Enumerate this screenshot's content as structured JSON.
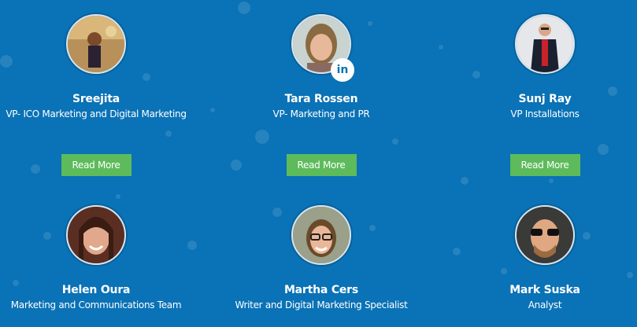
{
  "colors": {
    "background": "#0a72b6",
    "button": "#5dbb5b",
    "linkedin": "#0a72b6"
  },
  "team": [
    {
      "name": "Sreejita",
      "role": "VP- ICO Marketing and Digital Marketing",
      "button": "Read More",
      "avatar_icon": "person-photo"
    },
    {
      "name": "Tara Rossen",
      "role": "VP- Marketing and PR",
      "button": "Read More",
      "avatar_icon": "person-photo",
      "social_icon": "linkedin-icon",
      "social_label": "in"
    },
    {
      "name": "Sunj Ray",
      "role": "VP Installations",
      "button": "Read More",
      "avatar_icon": "person-photo"
    },
    {
      "name": "Helen Oura",
      "role": "Marketing and Communications Team",
      "avatar_icon": "person-photo"
    },
    {
      "name": "Martha Cers",
      "role": "Writer and Digital Marketing Specialist",
      "avatar_icon": "person-photo"
    },
    {
      "name": "Mark Suska",
      "role": "Analyst",
      "avatar_icon": "person-photo"
    }
  ]
}
